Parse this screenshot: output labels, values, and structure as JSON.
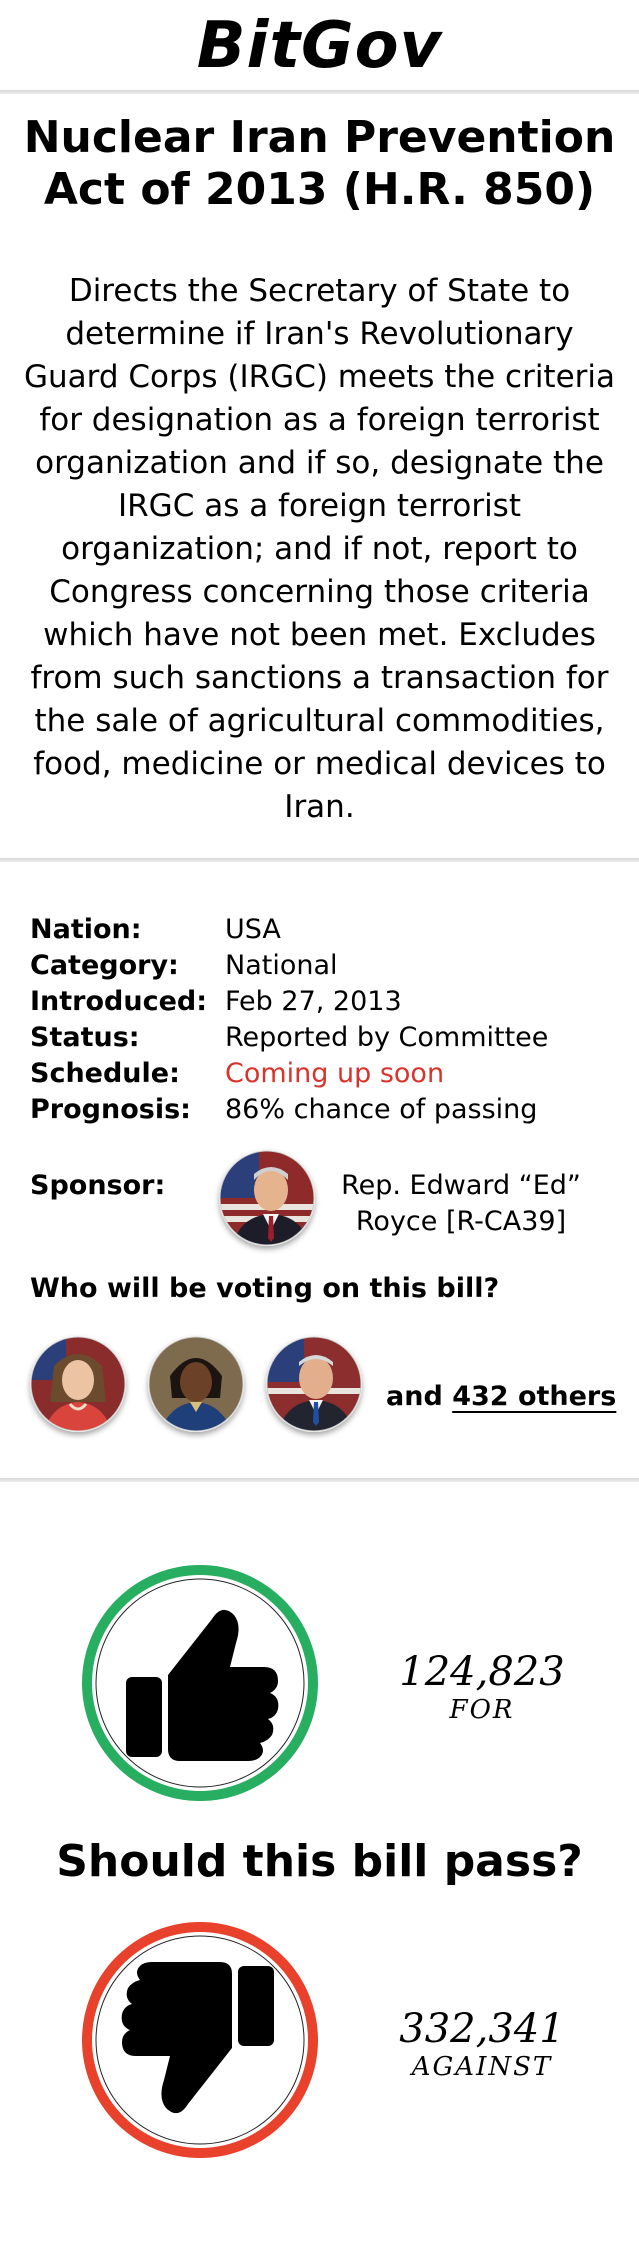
{
  "header": {
    "logo": "BitGov"
  },
  "bill": {
    "title": "Nuclear Iran Prevention Act of 2013 (H.R. 850)",
    "description": "Directs the Secretary of State to determine if Iran's Revolutionary Guard Corps (IRGC) meets the criteria for designation as a foreign terrorist organization and if so, designate the IRGC as a foreign terrorist organization; and if not, report to Congress concerning those criteria which have not been met. Excludes from such sanctions a transaction for the sale of agricultural commodities, food, medicine or medical devices to Iran."
  },
  "details": [
    {
      "label": "Nation:",
      "value": "USA"
    },
    {
      "label": "Category:",
      "value": "National"
    },
    {
      "label": "Introduced:",
      "value": "Feb 27, 2013"
    },
    {
      "label": "Status:",
      "value": "Reported by Committee"
    },
    {
      "label": "Schedule:",
      "value": "Coming up soon",
      "color": "#d9342b"
    },
    {
      "label": "Prognosis:",
      "value": "86% chance of passing"
    }
  ],
  "sponsor": {
    "label": "Sponsor:",
    "name_line1": "Rep. Edward “Ed”",
    "name_line2": "Royce [R-CA39]"
  },
  "voting": {
    "question": "Who will be voting on this bill?",
    "others_prefix": "and",
    "others_link": "432 others"
  },
  "poll": {
    "question": "Should this bill pass?",
    "for_count": "124,823",
    "for_label": "FOR",
    "against_count": "332,341",
    "against_label": "AGAINST",
    "for_color": "#27ae60",
    "against_color": "#e8412c"
  },
  "icons": {
    "thumbs_up": "thumbs-up-icon",
    "thumbs_down": "thumbs-down-icon"
  }
}
